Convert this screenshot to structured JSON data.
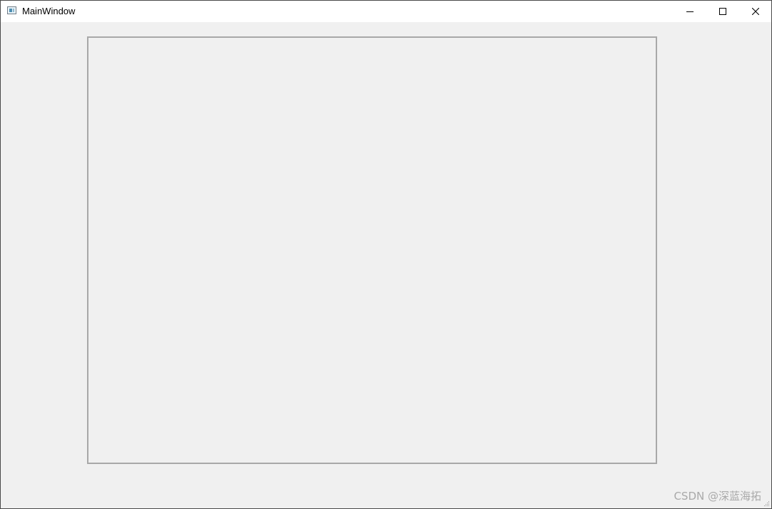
{
  "window": {
    "title": "MainWindow",
    "icon": "app-window-icon",
    "controls": {
      "minimize_icon": "minimize-icon",
      "maximize_icon": "maximize-icon",
      "close_icon": "close-icon"
    }
  },
  "watermark": {
    "text": "CSDN @深蓝海拓"
  },
  "colors": {
    "titlebar": "#ffffff",
    "client_background": "#f0f0f0",
    "frame_border": "#a8a8a8",
    "watermark": "#a9a9a9"
  }
}
